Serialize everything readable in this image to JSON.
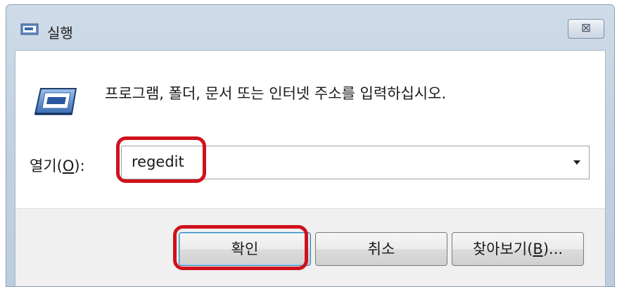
{
  "window": {
    "title": "실행",
    "close_symbol": "⊠",
    "icons": {
      "title": "run-icon",
      "close": "close-icon",
      "main": "run-program-icon",
      "dropdown": "chevron-down-icon"
    }
  },
  "prompt": "프로그램, 폴더, 문서 또는 인터넷 주소를 입력하십시오.",
  "open_field": {
    "label_before": "열기(",
    "label_accel": "O",
    "label_after": "):",
    "value": "regedit"
  },
  "buttons": {
    "ok": "확인",
    "cancel": "취소",
    "browse_before": "찾아보기(",
    "browse_accel": "B",
    "browse_after": ")..."
  },
  "colors": {
    "highlight": "#d0111b",
    "title_gradient": "#c3d2e2",
    "default_button_border": "#3c7fb1"
  }
}
